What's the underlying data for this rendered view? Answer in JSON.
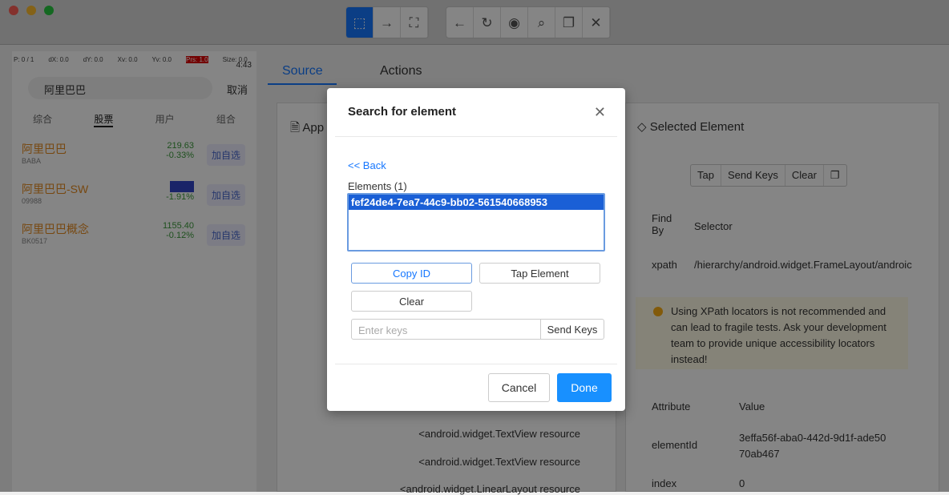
{
  "toolbar": {
    "group1": [
      "select-icon",
      "swipe-icon",
      "tap-icon"
    ],
    "group2": [
      "back-icon",
      "refresh-icon",
      "eye-icon",
      "search-icon",
      "copy-icon",
      "close-icon"
    ]
  },
  "device": {
    "pointer": [
      "P: 0 / 1",
      "dX: 0.0",
      "dY: 0.0",
      "Xv: 0.0",
      "Yv: 0.0",
      "Prs: 1.0",
      "Size: 0.0"
    ],
    "time": "4:43",
    "search_value": "阿里巴巴",
    "cancel": "取消",
    "tabs": [
      "综合",
      "股票",
      "用户",
      "组合"
    ],
    "rows": [
      {
        "name": "阿里巴巴",
        "code": "BABA",
        "price": "219.63",
        "change": "-0.33%",
        "add": "加自选"
      },
      {
        "name": "阿里巴巴-SW",
        "code": "09988",
        "price": "",
        "change": "-1.91%",
        "add": "加自选"
      },
      {
        "name": "阿里巴巴概念",
        "code": "BK0517",
        "price": "1155.40",
        "change": "-0.12%",
        "add": "加自选"
      }
    ]
  },
  "tabs": {
    "source": "Source",
    "actions": "Actions"
  },
  "source": {
    "title": "App Source",
    "nodes": [
      "<android.widget.TextView resource",
      "<android.widget.TextView resource",
      "<android.widget.LinearLayout resource"
    ]
  },
  "selected": {
    "title": "Selected Element",
    "actions": [
      "Tap",
      "Send Keys",
      "Clear"
    ],
    "find_by_header": "Find By",
    "selector_header": "Selector",
    "find_by": "xpath",
    "selector": "/hierarchy/android.widget.FrameLayout/androic",
    "warning": "Using XPath locators is not recommended and can lead to fragile tests. Ask your development team to provide unique accessibility locators instead!",
    "attr_header": "Attribute",
    "value_header": "Value",
    "attrs": [
      {
        "name": "elementId",
        "value": "3effa56f-aba0-442d-9d1f-ade5070ab467"
      },
      {
        "name": "index",
        "value": "0"
      }
    ]
  },
  "modal": {
    "title": "Search for element",
    "back": "<< Back",
    "elements_label": "Elements (1)",
    "elements": [
      "fef24de4-7ea7-44c9-bb02-561540668953"
    ],
    "copy_id": "Copy ID",
    "tap_element": "Tap Element",
    "clear": "Clear",
    "keys_placeholder": "Enter keys",
    "send_keys": "Send Keys",
    "cancel": "Cancel",
    "done": "Done"
  },
  "colors": {
    "accent": "#1677ff",
    "warning_bg": "#fffbe6"
  }
}
